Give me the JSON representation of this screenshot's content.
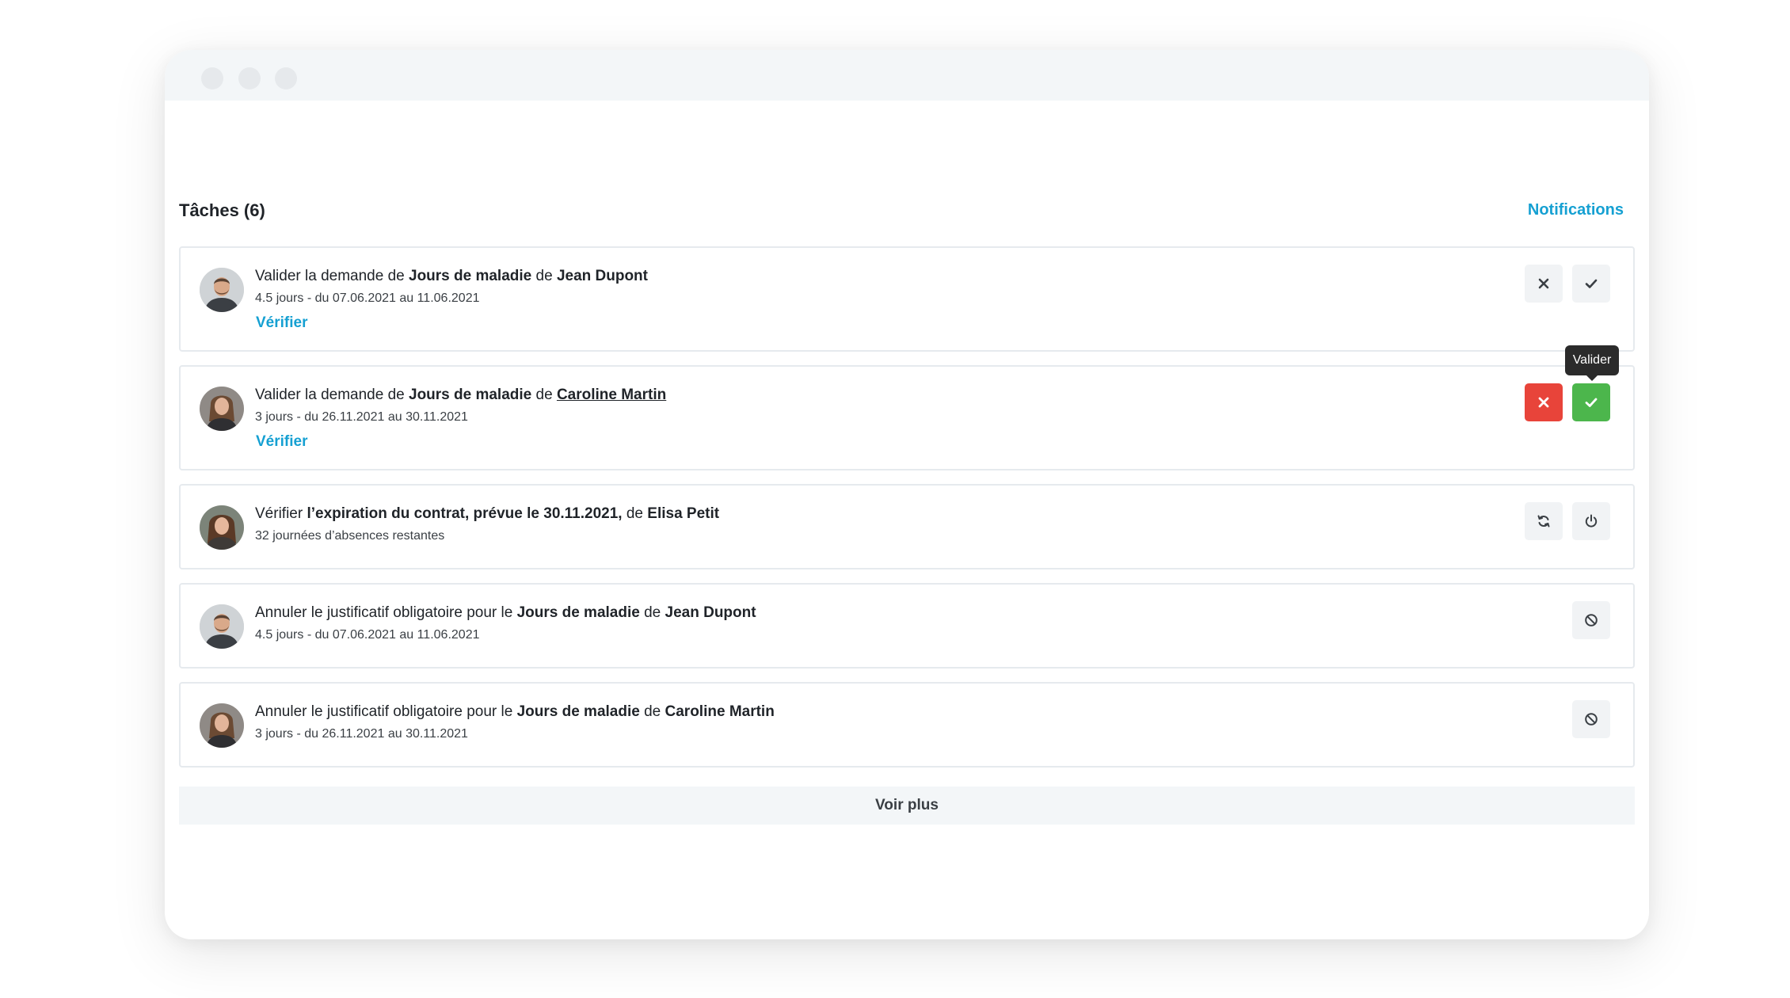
{
  "window": {
    "controls": [
      "close-dot",
      "minimize-dot",
      "maximize-dot"
    ]
  },
  "header": {
    "title": "Tâches (6)",
    "notifications_link": "Notifications"
  },
  "tasks": [
    {
      "prefix": "Valider la demande de ",
      "type": "Jours de maladie",
      "mid": " de ",
      "person": "Jean Dupont",
      "details": "4.5 jours - du 07.06.2021 au 11.06.2021",
      "link": "Vérifier",
      "actions": [
        "reject",
        "approve"
      ]
    },
    {
      "prefix": "Valider la demande de ",
      "type": "Jours de maladie",
      "mid": " de ",
      "person": "Caroline Martin",
      "details": "3 jours - du 26.11.2021 au 30.11.2021",
      "link": "Vérifier",
      "actions": [
        "reject",
        "approve"
      ],
      "tooltip": "Valider"
    },
    {
      "prefix": "Vérifier ",
      "type": "l’expiration du contrat, prévue le 30.11.2021,",
      "mid": " de ",
      "person": "Elisa Petit",
      "details": "32 journées d’absences restantes",
      "actions": [
        "renew",
        "terminate"
      ]
    },
    {
      "prefix": "Annuler le justificatif obligatoire pour le ",
      "type": "Jours de maladie",
      "mid": " de ",
      "person": "Jean Dupont",
      "details": "4.5 jours - du 07.06.2021 au 11.06.2021",
      "actions": [
        "cancel"
      ]
    },
    {
      "prefix": "Annuler le justificatif obligatoire pour le ",
      "type": "Jours de maladie",
      "mid": " de ",
      "person": "Caroline Martin",
      "details": "3 jours - du 26.11.2021 au 30.11.2021",
      "actions": [
        "cancel"
      ]
    }
  ],
  "footer": {
    "more_button": "Voir plus"
  },
  "colors": {
    "accent": "#15a0d2",
    "reject": "#e8443a",
    "approve": "#4cb64c",
    "neutral_button": "#f1f3f5"
  },
  "icons": {
    "reject": "close-icon",
    "approve": "check-icon",
    "renew": "refresh-icon",
    "terminate": "power-icon",
    "cancel": "ban-icon"
  }
}
